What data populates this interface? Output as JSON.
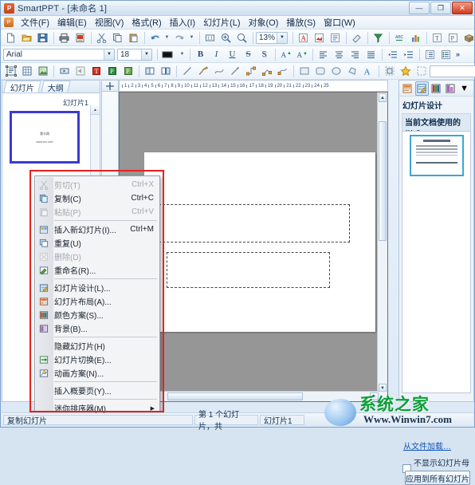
{
  "window": {
    "title": "SmartPPT - [未命名 1]",
    "app_icon": "powerpoint-icon",
    "minimize": "—",
    "maximize": "❐",
    "close": "✕"
  },
  "menubar": {
    "doc_icon": "document-icon",
    "items": [
      {
        "label": "文件(F)"
      },
      {
        "label": "编辑(E)"
      },
      {
        "label": "视图(V)"
      },
      {
        "label": "格式(R)"
      },
      {
        "label": "插入(I)"
      },
      {
        "label": "幻灯片(L)"
      },
      {
        "label": "对象(O)"
      },
      {
        "label": "播放(S)"
      },
      {
        "label": "窗口(W)"
      }
    ]
  },
  "toolbar_standard": {
    "zoom_value": "13%",
    "overflow": "»",
    "items": [
      {
        "name": "new-icon"
      },
      {
        "name": "open-icon"
      },
      {
        "name": "save-icon"
      },
      {
        "name": "print-icon"
      },
      {
        "name": "export-pdf-icon"
      },
      {
        "name": "cut-icon"
      },
      {
        "name": "copy-icon"
      },
      {
        "name": "paste-icon"
      },
      {
        "name": "undo-icon"
      },
      {
        "name": "redo-icon"
      },
      {
        "name": "fit-actual-size-icon"
      },
      {
        "name": "zoom-in-icon"
      },
      {
        "name": "zoom-find-icon"
      },
      {
        "name": "insert-text-icon"
      },
      {
        "name": "insert-image-icon"
      },
      {
        "name": "insert-list-icon"
      },
      {
        "name": "format-painter-icon"
      },
      {
        "name": "spellcheck-icon"
      },
      {
        "name": "translate-icon"
      },
      {
        "name": "chart-icon"
      },
      {
        "name": "table-icon"
      },
      {
        "name": "slide-show-icon"
      },
      {
        "name": "package-icon"
      }
    ]
  },
  "toolbar_format": {
    "font_name": "Arial",
    "font_size": "18",
    "overflow": "»",
    "items": [
      {
        "name": "font-color-icon"
      },
      {
        "name": "bold-icon",
        "label": "B"
      },
      {
        "name": "italic-icon",
        "label": "I"
      },
      {
        "name": "underline-icon",
        "label": "U"
      },
      {
        "name": "strikethrough-icon",
        "label": "S"
      },
      {
        "name": "shadow-icon",
        "label": "S"
      },
      {
        "name": "increase-font-icon",
        "label": "A"
      },
      {
        "name": "decrease-font-icon",
        "label": "A"
      },
      {
        "name": "align-left-icon"
      },
      {
        "name": "align-center-icon"
      },
      {
        "name": "align-right-icon"
      },
      {
        "name": "align-justify-icon"
      },
      {
        "name": "decrease-indent-icon"
      },
      {
        "name": "increase-indent-icon"
      },
      {
        "name": "numbered-list-icon"
      },
      {
        "name": "bulleted-list-icon"
      }
    ]
  },
  "toolbar_draw": {
    "style_value": "",
    "overflow": "»",
    "items": [
      {
        "name": "insert-textbox-icon"
      },
      {
        "name": "insert-table-icon"
      },
      {
        "name": "insert-picture-icon"
      },
      {
        "name": "insert-movie-icon"
      },
      {
        "name": "insert-sound-icon"
      },
      {
        "name": "insert-title-icon"
      },
      {
        "name": "insert-placeholder-icon"
      },
      {
        "name": "insert-slide-object-icon"
      },
      {
        "name": "group-icon"
      },
      {
        "name": "ungroup-icon"
      },
      {
        "name": "line-icon"
      },
      {
        "name": "freeform-icon"
      },
      {
        "name": "curve-icon"
      },
      {
        "name": "arrow-icon"
      },
      {
        "name": "connector-icon"
      },
      {
        "name": "polyline-icon"
      },
      {
        "name": "node-edit-icon"
      },
      {
        "name": "rectangle-icon"
      },
      {
        "name": "rounded-rect-icon"
      },
      {
        "name": "ellipse-icon"
      },
      {
        "name": "shapes-icon"
      },
      {
        "name": "wordart-icon"
      },
      {
        "name": "align-objects-icon"
      },
      {
        "name": "animation-star-icon"
      },
      {
        "name": "select-icon"
      }
    ]
  },
  "left_panel": {
    "tabs": [
      {
        "label": "幻灯片",
        "active": true
      },
      {
        "label": "大纲",
        "active": false
      }
    ],
    "slide_label": "幻灯片1",
    "thumbnail": {
      "title": "我卡网",
      "subtitle": "www.xxx.com"
    },
    "scroll_up": "▲",
    "scroll_down": "▼"
  },
  "ruler": {
    "corner_icon": "ruler-origin-icon",
    "numbers": [
      "1",
      "2",
      "3",
      "4",
      "5",
      "6",
      "7",
      "8",
      "9",
      "10",
      "11",
      "12",
      "13",
      "14",
      "15",
      "16",
      "17",
      "18",
      "19",
      "20",
      "21",
      "22",
      "23",
      "24",
      "25"
    ]
  },
  "canvas": {
    "placeholders": [
      {
        "name": "title-placeholder"
      },
      {
        "name": "subtitle-placeholder"
      }
    ],
    "scroll_up": "▲",
    "scroll_down": "▼",
    "scroll_left": "◄",
    "scroll_right": "►"
  },
  "context_menu": {
    "items": [
      {
        "label": "剪切(T)",
        "accel": "Ctrl+X",
        "icon": "cut-icon",
        "disabled": true,
        "submenu": false,
        "sep_after": false
      },
      {
        "label": "复制(C)",
        "accel": "Ctrl+C",
        "icon": "copy-icon",
        "disabled": false,
        "submenu": false,
        "sep_after": false
      },
      {
        "label": "粘贴(P)",
        "accel": "Ctrl+V",
        "icon": "paste-icon",
        "disabled": true,
        "submenu": false,
        "sep_after": true
      },
      {
        "label": "插入新幻灯片(I)...",
        "accel": "Ctrl+M",
        "icon": "new-slide-icon",
        "disabled": false,
        "submenu": false,
        "sep_after": false
      },
      {
        "label": "重复(U)",
        "accel": "",
        "icon": "duplicate-icon",
        "disabled": false,
        "submenu": false,
        "sep_after": false
      },
      {
        "label": "删除(D)",
        "accel": "",
        "icon": "delete-icon",
        "disabled": true,
        "submenu": false,
        "sep_after": false
      },
      {
        "label": "重命名(R)...",
        "accel": "",
        "icon": "rename-icon",
        "disabled": false,
        "submenu": false,
        "sep_after": true
      },
      {
        "label": "幻灯片设计(L)...",
        "accel": "",
        "icon": "slide-design-icon",
        "disabled": false,
        "submenu": false,
        "sep_after": false
      },
      {
        "label": "幻灯片布局(A)...",
        "accel": "",
        "icon": "slide-layout-icon",
        "disabled": false,
        "submenu": false,
        "sep_after": false
      },
      {
        "label": "颜色方案(S)...",
        "accel": "",
        "icon": "color-scheme-icon",
        "disabled": false,
        "submenu": false,
        "sep_after": false
      },
      {
        "label": "背景(B)...",
        "accel": "",
        "icon": "background-icon",
        "disabled": false,
        "submenu": false,
        "sep_after": true
      },
      {
        "label": "隐藏幻灯片(H)",
        "accel": "",
        "icon": "",
        "disabled": false,
        "submenu": false,
        "sep_after": false
      },
      {
        "label": "幻灯片切换(E)...",
        "accel": "",
        "icon": "transition-icon",
        "disabled": false,
        "submenu": false,
        "sep_after": false
      },
      {
        "label": "动画方案(N)...",
        "accel": "",
        "icon": "animation-icon",
        "disabled": false,
        "submenu": false,
        "sep_after": true
      },
      {
        "label": "插入概要页(Y)...",
        "accel": "",
        "icon": "",
        "disabled": false,
        "submenu": false,
        "sep_after": true
      },
      {
        "label": "迷你排序器(M)",
        "accel": "",
        "icon": "",
        "disabled": false,
        "submenu": true,
        "sep_after": false
      }
    ]
  },
  "right_pane": {
    "title": "幻灯片设计",
    "section": "当前文档使用的样式",
    "tools": [
      {
        "name": "design-templates-icon",
        "selected": false
      },
      {
        "name": "slide-design-icon",
        "selected": true
      },
      {
        "name": "color-schemes-icon",
        "selected": false
      },
      {
        "name": "animation-schemes-icon",
        "selected": false
      }
    ],
    "more": "▼",
    "load_link": "从文件加载…",
    "checkbox_label": "不显示幻灯片母板中的",
    "apply_button": "应用到所有幻灯片"
  },
  "statusbar": {
    "left": "复制幻灯片",
    "middle": "第 1 个幻灯片，共",
    "right": "幻灯片1"
  },
  "watermark": {
    "cn": "系统之家",
    "url": "Www.Winwin7.com",
    "badge": "windows-logo-icon"
  },
  "colors": {
    "accent": "#3b3bd0",
    "annotation": "#e8201c",
    "link": "#1559b8",
    "canvas_bg": "#969696",
    "watermark_green": "#0a9f36"
  }
}
